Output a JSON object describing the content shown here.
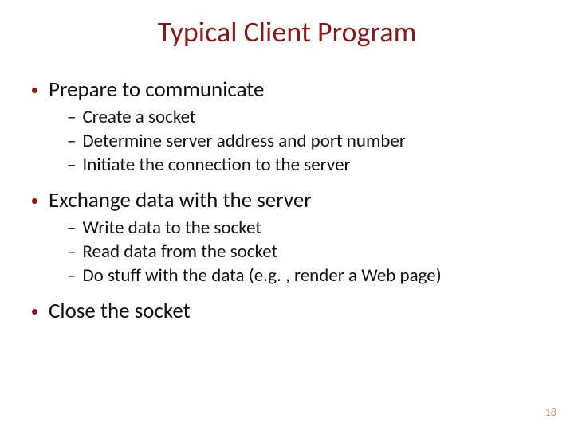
{
  "title": "Typical Client Program",
  "sections": [
    {
      "heading": "Prepare to communicate",
      "items": [
        "Create a socket",
        "Determine server address and port number",
        "Initiate the connection to the server"
      ]
    },
    {
      "heading": "Exchange data with the server",
      "items": [
        "Write data to the socket",
        "Read data from the socket",
        "Do stuff with the data (e.g. , render a Web page)"
      ]
    },
    {
      "heading": "Close the socket",
      "items": []
    }
  ],
  "dash": "–",
  "page_number": "18"
}
